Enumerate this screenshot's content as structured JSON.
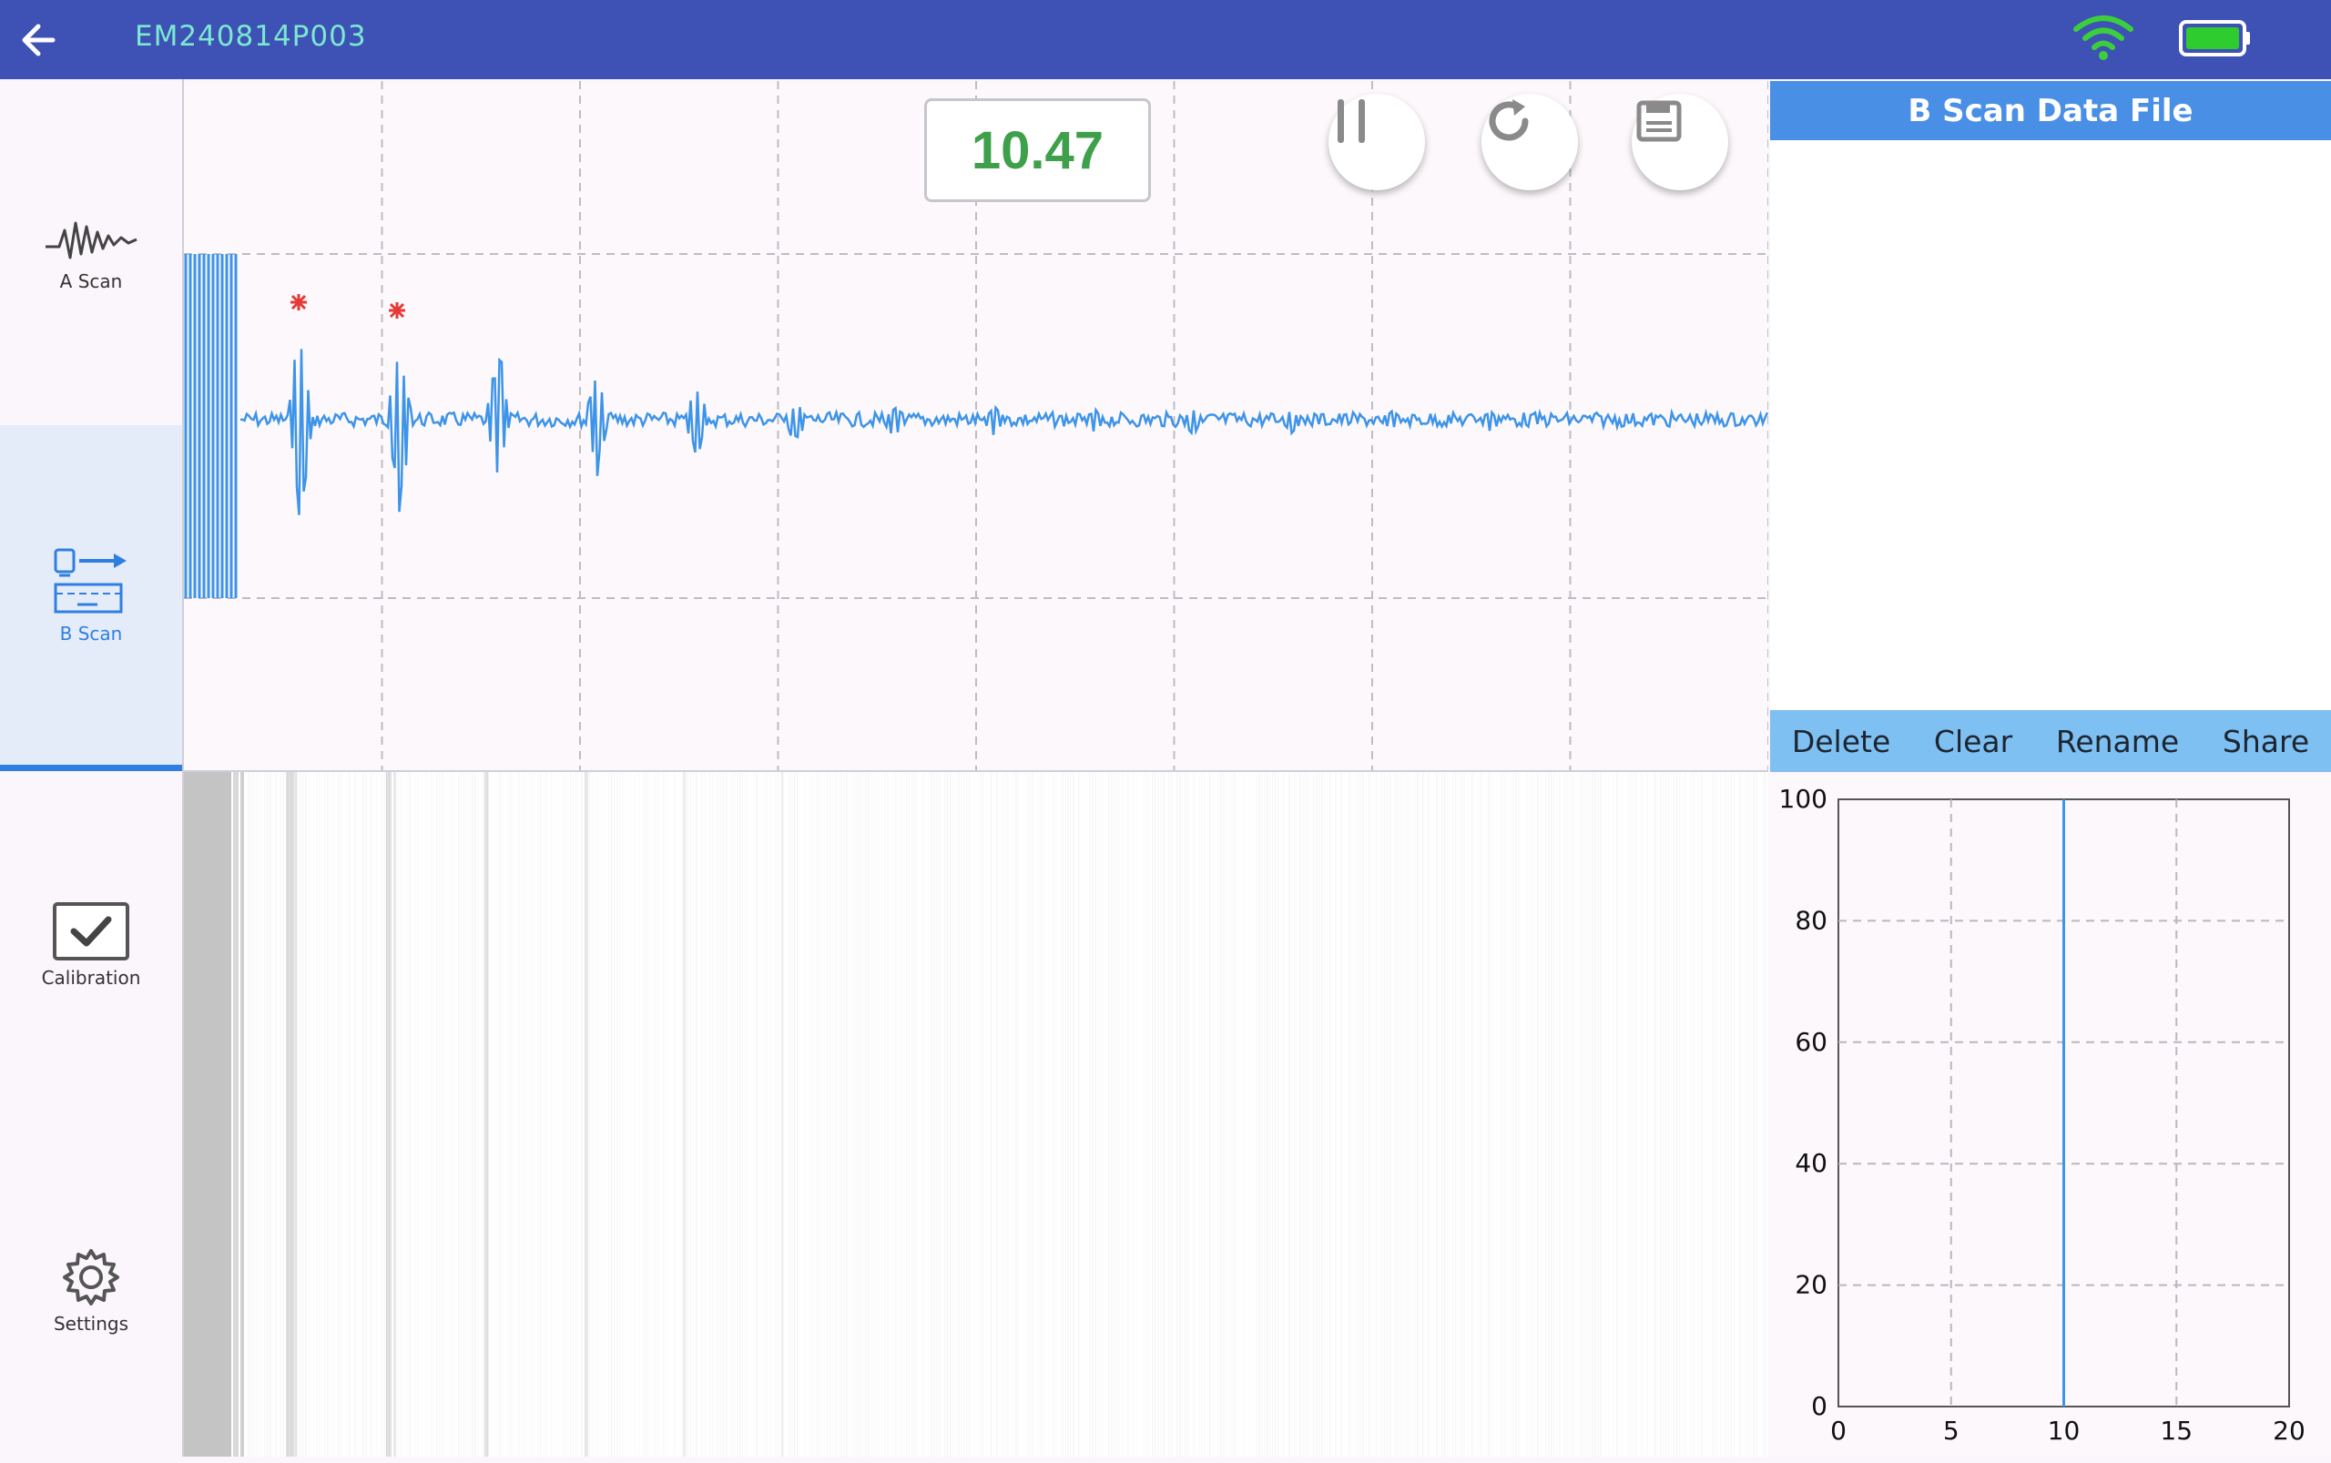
{
  "header": {
    "device_id": "EM240814P003"
  },
  "nav": {
    "items": [
      {
        "label": "A Scan"
      },
      {
        "label": "B Scan"
      },
      {
        "label": "Calibration"
      },
      {
        "label": "Settings"
      }
    ],
    "active": "B Scan"
  },
  "ascan": {
    "value": "10.47",
    "buttons": [
      "pause",
      "refresh",
      "save"
    ]
  },
  "right_panel": {
    "title": "B Scan Data File",
    "actions": {
      "delete": "Delete",
      "clear": "Clear",
      "rename": "Rename",
      "share": "Share"
    }
  },
  "colors": {
    "header": "#3e51b5",
    "accent": "#2f7fe0",
    "signal": "#3d94e8",
    "value_green": "#3ea04a",
    "panel_header": "#4a8fe6",
    "action_bar": "#7fc0f3",
    "marker": "#e53935"
  },
  "chart_data": {
    "type": "line",
    "x": [
      10,
      10
    ],
    "y": [
      0,
      100
    ],
    "xlim": [
      0,
      20
    ],
    "ylim": [
      0,
      100
    ],
    "xticks": [
      "0",
      "5",
      "10",
      "15",
      "20"
    ],
    "yticks": [
      "0",
      "20",
      "40",
      "60",
      "80",
      "100"
    ],
    "grid": true
  }
}
